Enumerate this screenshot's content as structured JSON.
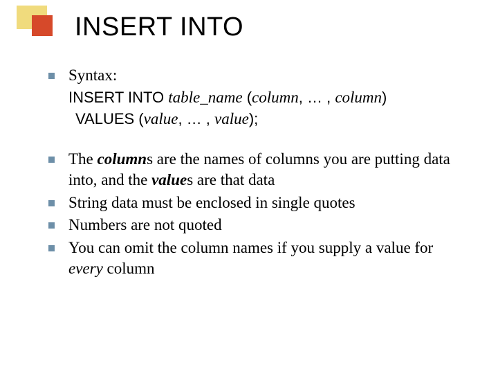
{
  "title": "INSERT INTO",
  "syntax_label": "Syntax:",
  "kw_insert_into": "INSERT INTO ",
  "kw_values": "VALUES (",
  "tok_table_name": "table_name",
  "tok_lparen": " (",
  "tok_column": "column",
  "tok_comma_dots": ", … , ",
  "tok_rparen": ")",
  "tok_value": "value",
  "tok_rparen_semi": ");",
  "b2a": "The ",
  "b2b": "column",
  "b2c": "s are the names of columns you are putting data into, and the ",
  "b2d": "value",
  "b2e": "s are that data",
  "b3": "String data must be enclosed in single quotes",
  "b4": "Numbers are not quoted",
  "b5a": "You can omit the column names if you supply a value for ",
  "b5b": "every",
  "b5c": " column"
}
